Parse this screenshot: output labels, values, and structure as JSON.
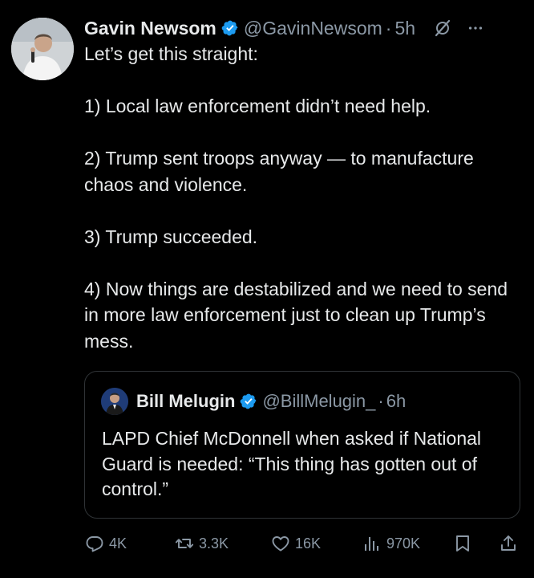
{
  "tweet": {
    "author_name": "Gavin Newsom",
    "handle": "@GavinNewsom",
    "separator": "·",
    "time": "5h",
    "paragraphs": [
      "Let’s get this straight:",
      "1) Local law enforcement didn’t need help.",
      "2) Trump sent troops anyway — to manufacture chaos and violence.",
      "3) Trump succeeded.",
      "4) Now things are destabilized and we need to send in more law enforcement just to clean up Trump’s mess."
    ]
  },
  "quote": {
    "author_name": "Bill Melugin",
    "handle": "@BillMelugin_",
    "separator": "·",
    "time": "6h",
    "text": "LAPD Chief McDonnell when asked if National Guard is needed: “This thing has gotten out of control.”"
  },
  "actions": {
    "replies": "4K",
    "reposts": "3.3K",
    "likes": "16K",
    "views": "970K"
  },
  "icons": {
    "verified": "verified-badge-icon",
    "grok": "grok-icon",
    "more": "more-icon",
    "reply": "reply-icon",
    "repost": "repost-icon",
    "like": "like-icon",
    "views": "views-icon",
    "bookmark": "bookmark-icon",
    "share": "share-icon"
  },
  "colors": {
    "background": "#000000",
    "text": "#e7e9ea",
    "secondary": "#8b98a5",
    "verified": "#1d9bf0",
    "border": "#2f3336"
  }
}
